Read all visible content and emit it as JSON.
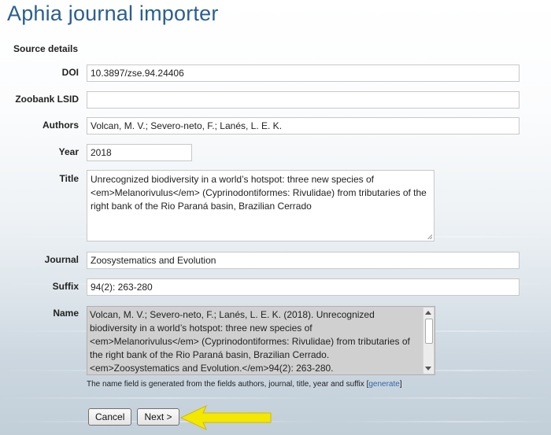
{
  "page": {
    "title": "Aphia journal importer",
    "section_heading": "Source details"
  },
  "form": {
    "doi": {
      "label": "DOI",
      "value": "10.3897/zse.94.24406"
    },
    "zoobank": {
      "label": "Zoobank LSID",
      "value": ""
    },
    "authors": {
      "label": "Authors",
      "value": "Volcan, M. V.; Severo-neto, F.; Lanés, L. E. K."
    },
    "year": {
      "label": "Year",
      "value": "2018"
    },
    "title": {
      "label": "Title",
      "value": "Unrecognized biodiversity in a world’s hotspot: three new species of <em>Melanorivulus</em> (Cyprinodontiformes: Rivulidae) from tributaries of the right bank of the Rio Paraná basin, Brazilian Cerrado"
    },
    "journal": {
      "label": "Journal",
      "value": "Zoosystematics and Evolution"
    },
    "suffix": {
      "label": "Suffix",
      "value": "94(2): 263-280"
    },
    "name": {
      "label": "Name",
      "value": "Volcan, M. V.; Severo-neto, F.; Lanés, L. E. K. (2018). Unrecognized biodiversity in a world’s hotspot: three new species of <em>Melanorivulus</em> (Cyprinodontiformes: Rivulidae) from tributaries of the right bank of the Rio Paraná basin, Brazilian Cerrado. <em>Zoosystematics and Evolution.</em>94(2): 263-280."
    }
  },
  "note": {
    "text": "The name field is generated from the fields authors, journal, title, year and suffix",
    "bracket_open": "[",
    "link_label": "generate",
    "bracket_close": "]"
  },
  "buttons": {
    "cancel": "Cancel",
    "next": "Next >"
  },
  "colors": {
    "title": "#2b5f8e",
    "arrow": "#f2e800"
  }
}
